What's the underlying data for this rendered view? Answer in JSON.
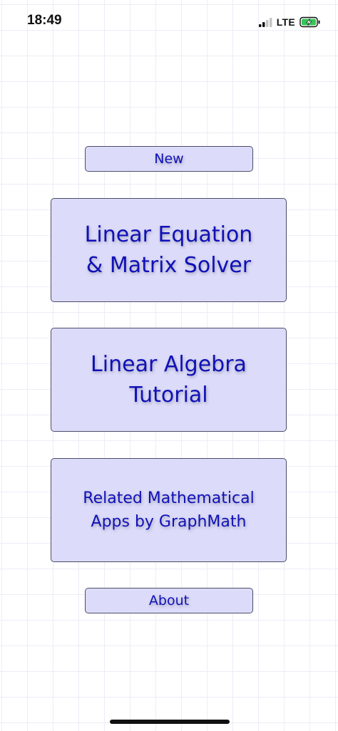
{
  "status_bar": {
    "time": "18:49",
    "network": "LTE",
    "signal_icon": "signal-bars-icon",
    "battery_icon": "battery-charging-icon",
    "battery_color": "#35c759"
  },
  "menu": {
    "new_label": "New",
    "solver_label": "Linear Equation\n& Matrix Solver",
    "tutorial_label": "Linear Algebra\nTutorial",
    "related_label": "Related Mathematical\nApps by GraphMath",
    "about_label": "About"
  },
  "colors": {
    "button_fill": "#dcdcfa",
    "button_text": "#1010b8",
    "button_border": "#4c4c6a",
    "grid_line": "#eceef6"
  }
}
